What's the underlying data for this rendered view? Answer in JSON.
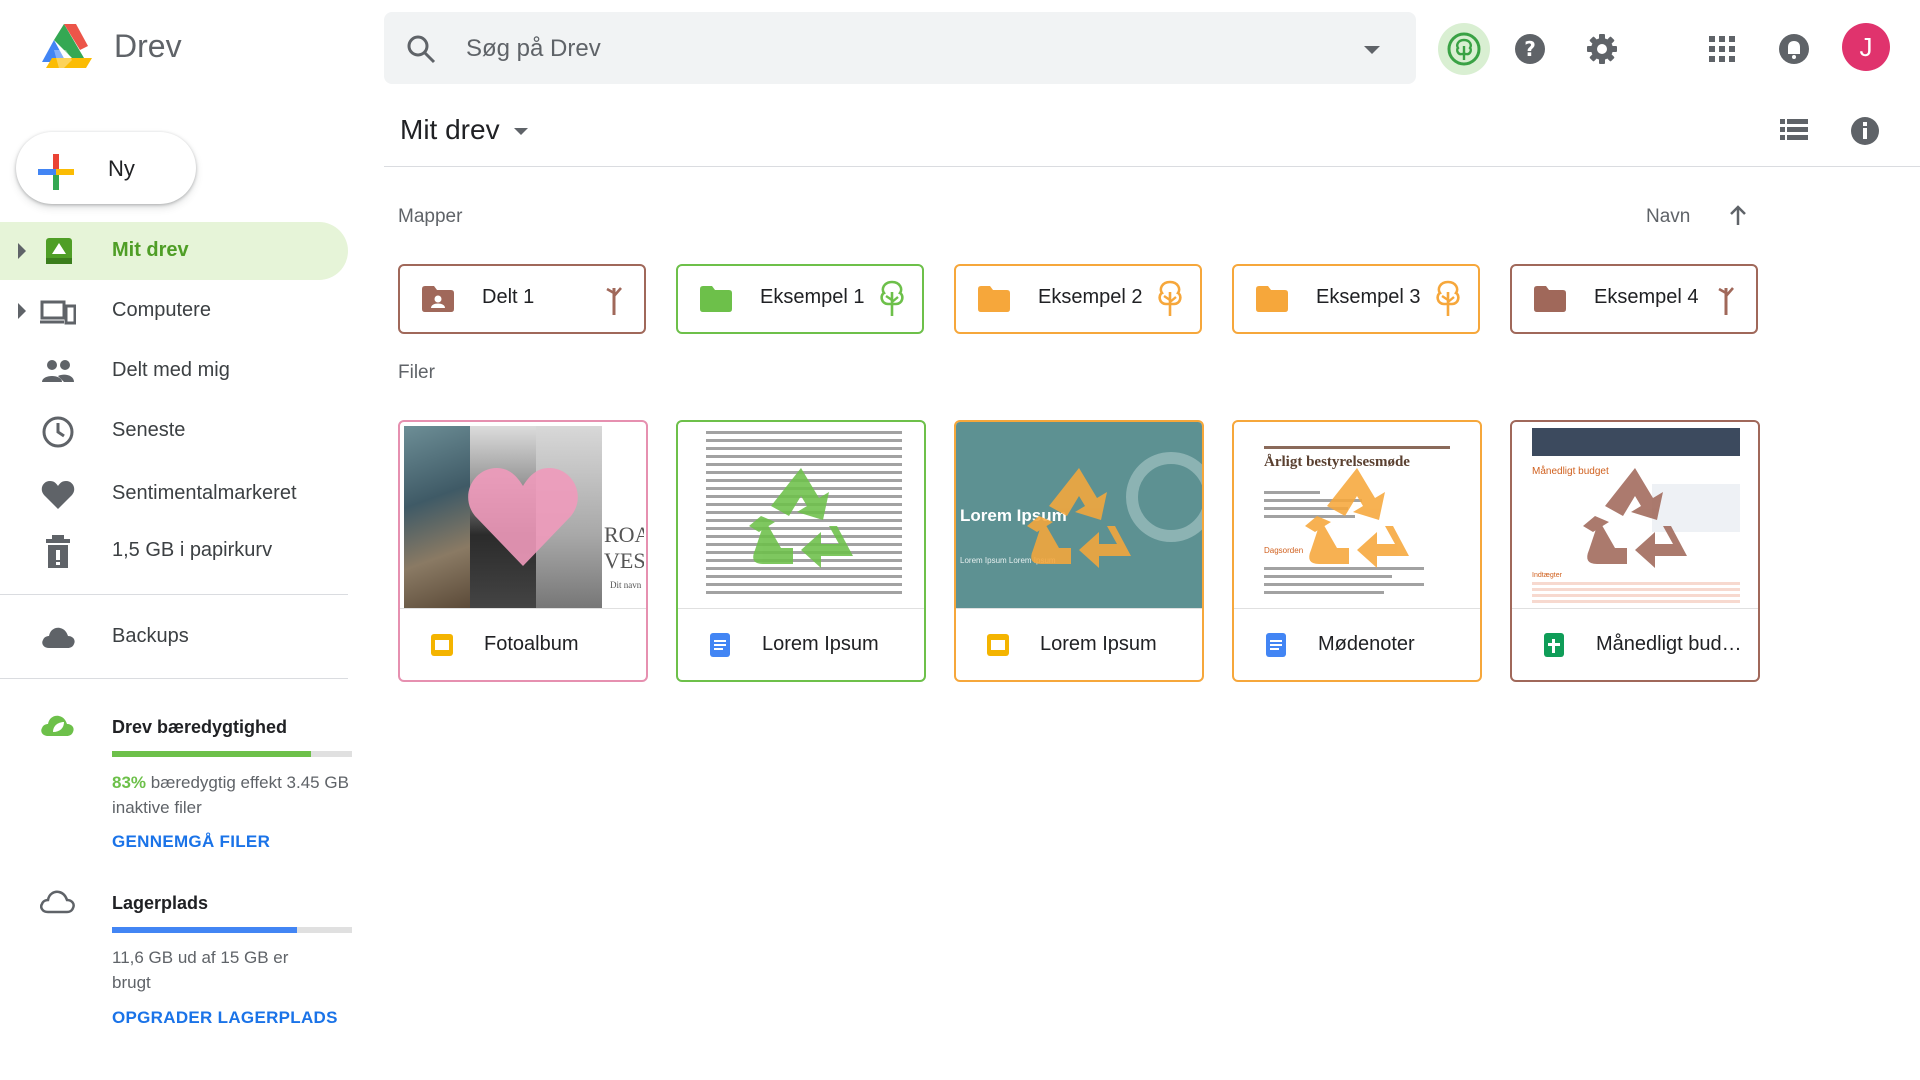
{
  "app": {
    "brand": "Drev",
    "icons": [
      "drive-logo-icon",
      "search-icon",
      "eco-tree-icon",
      "help-icon",
      "settings-icon",
      "apps-grid-icon",
      "bell-icon"
    ]
  },
  "search": {
    "placeholder": "Søg på Drev",
    "value": ""
  },
  "account": {
    "initial": "J",
    "color": "#e0336d"
  },
  "new_button": {
    "label": "Ny"
  },
  "sidebar": {
    "items": [
      {
        "label": "Mit drev",
        "icon": "drive-folder-icon",
        "active": true
      },
      {
        "label": "Computere",
        "icon": "computers-icon"
      },
      {
        "label": "Delt med mig",
        "icon": "people-icon"
      },
      {
        "label": "Seneste",
        "icon": "clock-icon"
      },
      {
        "label": "Sentimentalmarkeret",
        "icon": "heart-icon"
      },
      {
        "label": "1,5 GB i papirkurv",
        "icon": "trash-icon"
      },
      {
        "label": "Backups",
        "icon": "cloud-icon"
      }
    ],
    "sustainability": {
      "title": "Drev bæredygtighed",
      "percent": "83%",
      "text": "bæredygtig effekt 3.45 GB inaktive filer",
      "link": "GENNEMGÅ FILER",
      "fill": 0.83,
      "color": "#6dc04a"
    },
    "storage": {
      "title": "Lagerplads",
      "text": "11,6 GB ud af 15 GB er brugt",
      "link": "OPGRADER LAGERPLADS",
      "fill": 0.77,
      "color": "#4285f4"
    }
  },
  "main": {
    "title": "Mit drev",
    "folders_label": "Mapper",
    "files_label": "Filer",
    "sort_label": "Navn",
    "folders": [
      {
        "name": "Delt 1",
        "icon": "shared-folder-icon",
        "status": "dead-tree",
        "color": "#a0685a"
      },
      {
        "name": "Eksempel 1",
        "icon": "folder-icon",
        "status": "healthy-tree",
        "color": "#6dc04a"
      },
      {
        "name": "Eksempel 2",
        "icon": "folder-icon",
        "status": "healthy-tree",
        "color": "#f6a73b"
      },
      {
        "name": "Eksempel 3",
        "icon": "folder-icon",
        "status": "healthy-tree",
        "color": "#f6a73b"
      },
      {
        "name": "Eksempel 4",
        "icon": "folder-icon",
        "status": "dead-tree",
        "color": "#a0685a"
      }
    ],
    "files": [
      {
        "name": "Fotoalbum",
        "type": "slides",
        "color": "#e690b0",
        "thumb_text": "ROA VES",
        "thumb_subtext": "Dit navn"
      },
      {
        "name": "Lorem Ipsum",
        "type": "docs",
        "color": "#6dc04a"
      },
      {
        "name": "Lorem Ipsum",
        "type": "slides",
        "color": "#f6a73b",
        "thumb_text": "Lorem Ipsum",
        "thumb_subtext": "Lorem Ipsum Lorem Ipsum"
      },
      {
        "name": "Mødenoter",
        "type": "docs",
        "color": "#f6a73b",
        "thumb_text": "Årligt bestyrelsesmøde",
        "thumb_subtext": "Dagsorden"
      },
      {
        "name": "Månedligt bud…",
        "type": "sheets",
        "color": "#a0685a",
        "thumb_text": "Månedligt budget",
        "thumb_subtext": "Indtægter"
      }
    ]
  },
  "colors": {
    "green": "#6dc04a",
    "orange": "#f6a73b",
    "brown": "#a0685a",
    "pink": "#e690b0",
    "blue_link": "#1a73e8"
  }
}
